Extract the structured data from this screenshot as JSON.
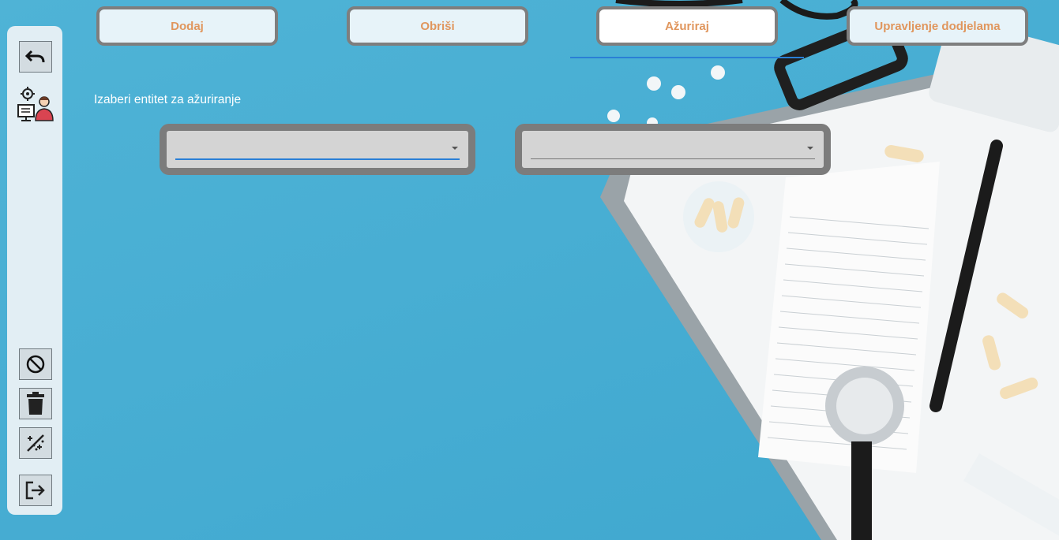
{
  "tabs": [
    {
      "label": "Dodaj",
      "active": false
    },
    {
      "label": "Obriši",
      "active": false
    },
    {
      "label": "Ažuriraj",
      "active": true
    },
    {
      "label": "Upravljenje dodjelama",
      "active": false
    }
  ],
  "main": {
    "select_label": "Izaberi entitet za  ažuriranje",
    "combo_primary": {
      "value": ""
    },
    "combo_secondary": {
      "value": ""
    }
  },
  "sidebar": {
    "icons": [
      "undo-icon",
      "admin-user-icon",
      "cancel-icon",
      "trash-icon",
      "clear-icon",
      "logout-icon"
    ]
  },
  "colors": {
    "accent": "#2a7fd6",
    "tab_text": "#e0965d",
    "tab_border": "#7e7e7e",
    "background": "#4fb3d6"
  }
}
